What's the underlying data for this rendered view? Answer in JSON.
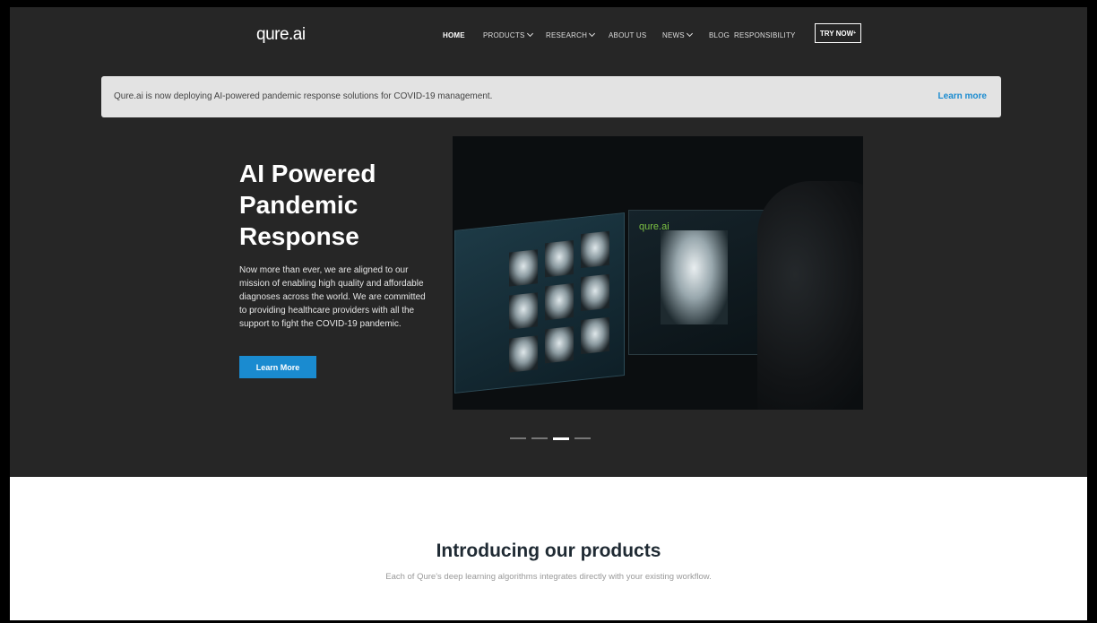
{
  "brand": {
    "logo_text": "qure.ai"
  },
  "nav": {
    "items": [
      {
        "label": "HOME",
        "active": true,
        "dropdown": false
      },
      {
        "label": "PRODUCTS",
        "active": false,
        "dropdown": true
      },
      {
        "label": "RESEARCH",
        "active": false,
        "dropdown": true
      },
      {
        "label": "ABOUT US",
        "active": false,
        "dropdown": false
      },
      {
        "label": "NEWS",
        "active": false,
        "dropdown": true
      },
      {
        "label": "BLOG",
        "active": false,
        "dropdown": false
      },
      {
        "label": "RESPONSIBILITY",
        "active": false,
        "dropdown": false
      }
    ],
    "try_now": "TRY NOW",
    "try_now_sup": "+"
  },
  "banner": {
    "text": "Qure.ai is now deploying AI-powered pandemic response solutions for COVID-19 management.",
    "link": "Learn more"
  },
  "hero": {
    "title": "AI Powered Pandemic Response",
    "description": "Now more than ever, we are aligned to our mission of enabling high quality and affordable diagnoses across the world. We are committed to providing healthcare providers with all the support to fight the COVID-19 pandemic.",
    "button": "Learn More",
    "image_watermark": "qure.ai",
    "carousel": {
      "count": 4,
      "active_index": 2
    }
  },
  "products": {
    "title": "Introducing our products",
    "subtitle": "Each of Qure's deep learning algorithms integrates directly with your existing workflow."
  },
  "colors": {
    "hero_bg": "#262626",
    "accent": "#1a8bd0",
    "banner_bg": "#e3e3e3"
  }
}
